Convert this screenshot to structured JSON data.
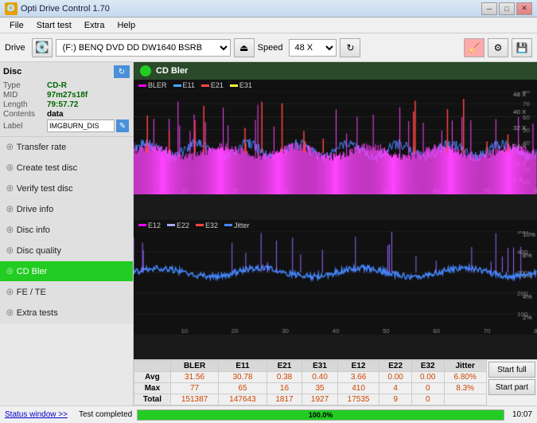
{
  "titlebar": {
    "title": "Opti Drive Control 1.70",
    "icon": "💿",
    "minimize": "─",
    "maximize": "□",
    "close": "✕"
  },
  "menubar": {
    "items": [
      "File",
      "Start test",
      "Extra",
      "Help"
    ]
  },
  "toolbar": {
    "drive_label": "Drive",
    "drive_value": "(F:)  BENQ DVD DD DW1640 BSRB",
    "speed_label": "Speed",
    "speed_value": "48 X"
  },
  "disc": {
    "title": "Disc",
    "type_label": "Type",
    "type_value": "CD-R",
    "mid_label": "MID",
    "mid_value": "97m27s18f",
    "length_label": "Length",
    "length_value": "79:57.72",
    "contents_label": "Contents",
    "contents_value": "data",
    "label_label": "Label",
    "label_value": "IMGBURN_DIS"
  },
  "nav": {
    "items": [
      {
        "id": "transfer-rate",
        "label": "Transfer rate",
        "active": false
      },
      {
        "id": "create-test-disc",
        "label": "Create test disc",
        "active": false
      },
      {
        "id": "verify-test-disc",
        "label": "Verify test disc",
        "active": false
      },
      {
        "id": "drive-info",
        "label": "Drive info",
        "active": false
      },
      {
        "id": "disc-info",
        "label": "Disc info",
        "active": false
      },
      {
        "id": "disc-quality",
        "label": "Disc quality",
        "active": false
      },
      {
        "id": "cd-bler",
        "label": "CD Bler",
        "active": true
      },
      {
        "id": "fe-te",
        "label": "FE / TE",
        "active": false
      },
      {
        "id": "extra-tests",
        "label": "Extra tests",
        "active": false
      }
    ]
  },
  "chart": {
    "title": "CD Bler",
    "legend1": [
      "BLER",
      "E11",
      "E21",
      "E31"
    ],
    "legend2": [
      "E12",
      "E22",
      "E32",
      "Jitter"
    ],
    "legend1_colors": [
      "#ff00ff",
      "#00aaff",
      "#ff4444",
      "#ffff00"
    ],
    "legend2_colors": [
      "#ff00ff",
      "#8888ff",
      "#ff4444",
      "#4488ff"
    ]
  },
  "stats": {
    "headers": [
      "",
      "BLER",
      "E11",
      "E21",
      "E31",
      "E12",
      "E22",
      "E32",
      "Jitter",
      ""
    ],
    "avg": {
      "label": "Avg",
      "bler": "31.56",
      "e11": "30.78",
      "e21": "0.38",
      "e31": "0.40",
      "e12": "3.66",
      "e22": "0.00",
      "e32": "0.00",
      "jitter": "6.80%"
    },
    "max": {
      "label": "Max",
      "bler": "77",
      "e11": "65",
      "e21": "16",
      "e31": "35",
      "e12": "410",
      "e22": "4",
      "e32": "0",
      "jitter": "8.3%"
    },
    "total": {
      "label": "Total",
      "bler": "151387",
      "e11": "147643",
      "e21": "1817",
      "e31": "1927",
      "e12": "17535",
      "e22": "9",
      "e32": "0",
      "jitter": ""
    },
    "btn_full": "Start full",
    "btn_part": "Start part"
  },
  "statusbar": {
    "status_window": "Status window >>",
    "status_text": "Test completed",
    "progress": "100.0%",
    "time": "10:07"
  }
}
